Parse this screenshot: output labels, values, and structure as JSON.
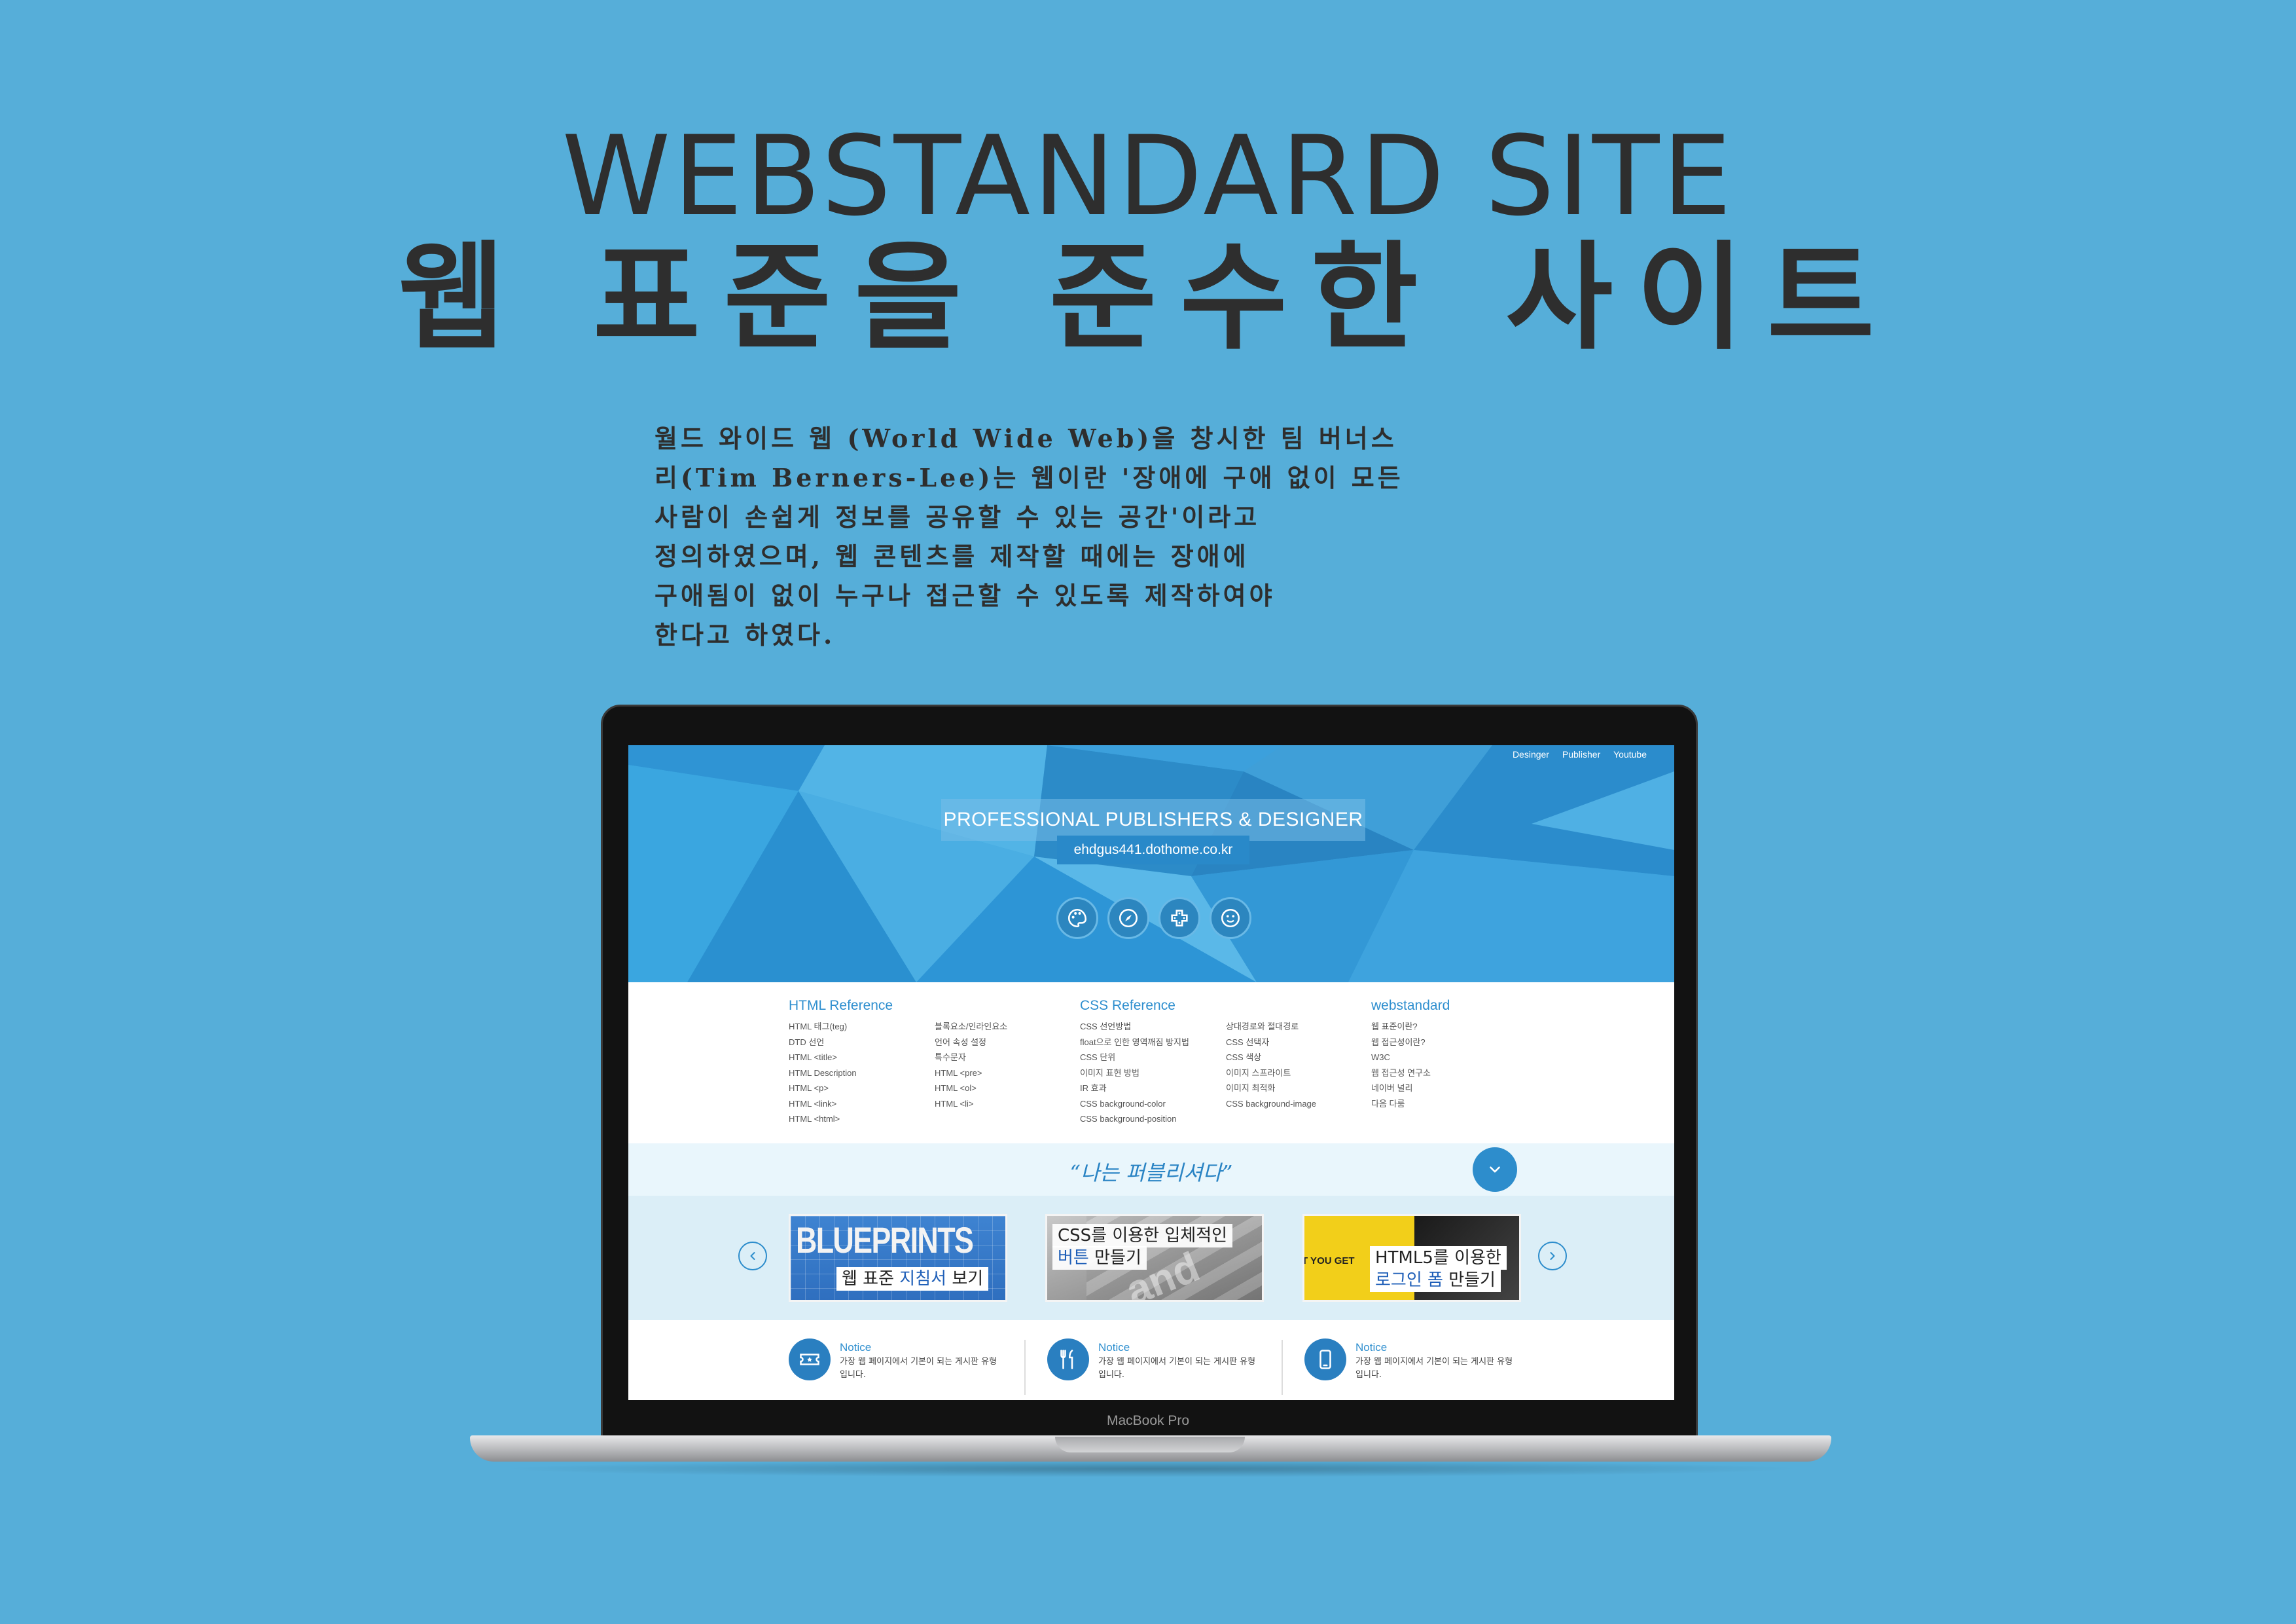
{
  "headline": {
    "en": "WEBSTANDARD SITE",
    "ko": "웹 표준을 준수한 사이트"
  },
  "intro": [
    "월드 와이드 웹 (World Wide Web)을 창시한 팀 버너스",
    "리(Tim Berners-Lee)는 웹이란 '장애에 구애 없이 모든",
    "사람이 손쉽게 정보를 공유할 수 있는 공간'이라고",
    "정의하였으며, 웹 콘텐츠를 제작할 때에는 장애에",
    "구애됨이 없이 누구나 접근할 수 있도록 제작하여야",
    "한다고 하였다."
  ],
  "device_label": "MacBook Pro",
  "site": {
    "topnav": [
      "Desinger",
      "Publisher",
      "Youtube"
    ],
    "hero_title": "PROFESSIONAL PUBLISHERS & DESIGNER",
    "hero_url": "ehdgus441.dothome.co.kr",
    "hero_icons": [
      "palette-icon",
      "compass-icon",
      "gamepad-icon",
      "face-icon"
    ],
    "html_ref": {
      "heading": "HTML Reference",
      "col1": [
        "HTML 태그(teg)",
        "DTD 선언",
        "HTML <title>",
        "HTML Description",
        "HTML <p>",
        "HTML <link>",
        "HTML <html>"
      ],
      "col2": [
        "블록요소/인라인요소",
        "언어 속성 설정",
        "특수문자",
        "HTML <pre>",
        "HTML <ol>",
        "HTML <li>"
      ]
    },
    "css_ref": {
      "heading": "CSS Reference",
      "col1": [
        "CSS 선언방법",
        "float으로 인한 영역깨짐 방지법",
        "CSS 단위",
        "이미지 표현 방법",
        "IR 효과",
        "CSS background-color",
        "CSS background-position"
      ],
      "col2": [
        "상대경로와 절대경로",
        "CSS 선택자",
        "CSS 색상",
        "이미지 스프라이트",
        "이미지 최적화",
        "CSS background-image"
      ]
    },
    "webstd_ref": {
      "heading": "webstandard",
      "col1": [
        "웹 표준이란?",
        "웹 접근성이란?",
        "W3C",
        "웹 접근성 연구소",
        "네이버 널리",
        "다음 다룸"
      ]
    },
    "slogan": "“나는 퍼블리셔다”",
    "banners": [
      {
        "image_text": "BLUEPRINTS",
        "caption_a": "웹 표준 ",
        "caption_hl": "지침서",
        "caption_b": " 보기"
      },
      {
        "image_text": "and inte",
        "line1": "CSS를 이용한 입체적인",
        "line2_hl": "버튼",
        "line2": " 만들기"
      },
      {
        "image_text": "T YOU GET",
        "line1": "HTML5를 이용한",
        "line2_hl": "로그인 폼",
        "line2": " 만들기"
      }
    ],
    "notices": [
      {
        "title": "Notice",
        "desc": "가장 웹 페이지에서 기본이 되는 게시판 유형입니다.",
        "icon": "ticket-icon"
      },
      {
        "title": "Notice",
        "desc": "가장 웹 페이지에서 기본이 되는 게시판 유형입니다.",
        "icon": "fork-knife-icon"
      },
      {
        "title": "Notice",
        "desc": "가장 웹 페이지에서 기본이 되는 게시판 유형입니다.",
        "icon": "mobile-icon"
      }
    ]
  },
  "colors": {
    "background": "#56aed9",
    "accent": "#2f8fcf",
    "headline": "#2e2e2e"
  }
}
